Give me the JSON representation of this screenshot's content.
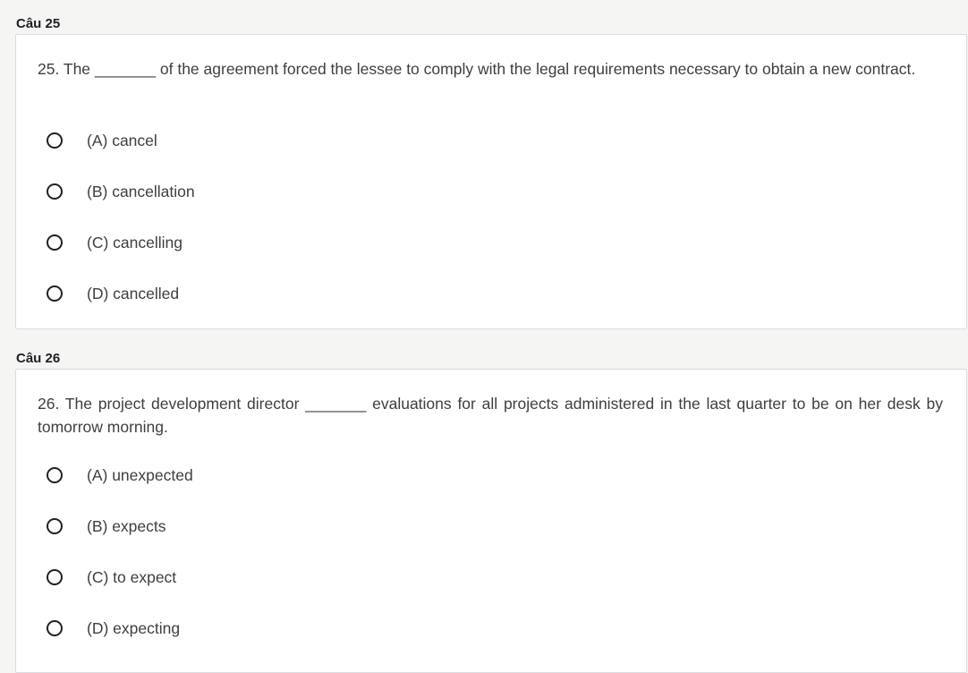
{
  "questions": [
    {
      "label": "Câu 25",
      "text": "25. The _______ of the agreement forced the lessee to comply with the legal requirements necessary to obtain a new contract.",
      "options": [
        "(A) cancel",
        "(B) cancellation",
        "(C) cancelling",
        "(D) cancelled"
      ]
    },
    {
      "label": "Câu 26",
      "text": "26. The project development director _______ evaluations for all projects administered in the last quarter to be on her desk by tomorrow morning.",
      "options": [
        "(A) unexpected",
        "(B) expects",
        "(C) to expect",
        "(D) expecting"
      ]
    }
  ]
}
